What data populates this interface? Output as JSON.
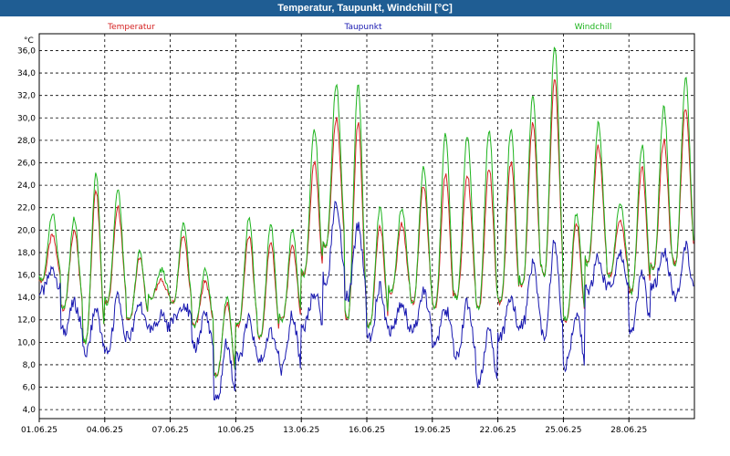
{
  "window": {
    "title": "Temperatur, Taupunkt, Windchill [°C]"
  },
  "chart_data": {
    "type": "line",
    "title": "Temperatur, Taupunkt, Windchill [°C]",
    "ylabel": "°C",
    "xlabel": "",
    "ylim": [
      3.2,
      37.5
    ],
    "y_ticks": [
      4.0,
      6.0,
      8.0,
      10.0,
      12.0,
      14.0,
      16.0,
      18.0,
      20.0,
      22.0,
      24.0,
      26.0,
      28.0,
      30.0,
      32.0,
      34.0,
      36.0
    ],
    "y_tick_labels": [
      "4,0",
      "6,0",
      "8,0",
      "10,0",
      "12,0",
      "14,0",
      "16,0",
      "18,0",
      "20,0",
      "22,0",
      "24,0",
      "26,0",
      "28,0",
      "30,0",
      "32,0",
      "34,0",
      "36,0"
    ],
    "x_range_days": [
      "01.06.25",
      "30.06.25 24:00"
    ],
    "x_ticks": [
      "01.06.25",
      "04.06.25",
      "07.06.25",
      "10.06.25",
      "13.06.25",
      "16.06.25",
      "19.06.25",
      "22.06.25",
      "25.06.25",
      "28.06.25"
    ],
    "grid": true,
    "legend_position": "top",
    "colors": {
      "temperatur": "#d42020",
      "taupunkt": "#1818b0",
      "windchill": "#1eb41e",
      "grid": "#000000"
    },
    "series": [
      {
        "name": "Temperatur",
        "color": "#d42020",
        "daily_min": [
          15.5,
          13.0,
          10.0,
          13.5,
          12.0,
          14.0,
          13.5,
          11.5,
          7.0,
          11.5,
          10.5,
          12.0,
          16.0,
          18.5,
          12.0,
          11.5,
          14.5,
          13.5,
          13.0,
          14.0,
          13.0,
          13.5,
          15.0,
          16.0,
          12.0,
          17.0,
          16.0,
          14.5,
          16.5,
          17.0
        ],
        "daily_max": [
          19.5,
          20.0,
          23.5,
          22.0,
          17.5,
          15.5,
          19.5,
          15.5,
          13.5,
          19.5,
          19.0,
          18.5,
          26.0,
          30.0,
          29.5,
          20.5,
          20.5,
          24.0,
          25.0,
          25.0,
          25.5,
          26.0,
          29.5,
          33.5,
          20.5,
          27.5,
          21.0,
          25.5,
          28.0,
          31.0
        ]
      },
      {
        "name": "Taupunkt",
        "color": "#1818b0",
        "daily_min": [
          14.5,
          11.0,
          9.0,
          9.0,
          10.5,
          11.0,
          12.0,
          9.5,
          4.8,
          8.5,
          8.5,
          7.5,
          11.5,
          15.5,
          14.0,
          10.5,
          11.0,
          11.0,
          10.0,
          9.0,
          6.5,
          10.5,
          11.5,
          10.5,
          8.0,
          14.5,
          15.0,
          11.0,
          15.0,
          14.0
        ],
        "daily_max": [
          16.5,
          13.5,
          13.0,
          14.0,
          13.5,
          12.5,
          13.5,
          12.5,
          10.0,
          12.0,
          11.0,
          12.5,
          14.5,
          22.5,
          20.5,
          15.0,
          13.5,
          14.5,
          13.0,
          13.5,
          11.0,
          14.0,
          17.0,
          19.0,
          12.5,
          17.5,
          18.0,
          16.5,
          18.0,
          18.5
        ]
      },
      {
        "name": "Windchill",
        "color": "#1eb41e",
        "daily_min": [
          15.5,
          13.0,
          10.0,
          13.5,
          12.0,
          14.0,
          13.5,
          11.5,
          7.0,
          11.5,
          10.5,
          12.0,
          16.0,
          18.5,
          12.0,
          11.5,
          14.5,
          13.5,
          13.0,
          14.0,
          13.0,
          13.5,
          15.0,
          16.0,
          12.0,
          17.0,
          16.0,
          14.5,
          16.5,
          17.0
        ],
        "daily_max": [
          21.5,
          21.0,
          25.0,
          23.5,
          18.0,
          16.5,
          20.5,
          16.5,
          14.0,
          21.0,
          20.5,
          20.0,
          29.0,
          33.0,
          33.0,
          22.0,
          22.0,
          25.5,
          28.5,
          28.5,
          29.0,
          29.0,
          32.0,
          36.5,
          21.5,
          29.5,
          22.5,
          27.5,
          31.0,
          33.5
        ]
      }
    ]
  }
}
